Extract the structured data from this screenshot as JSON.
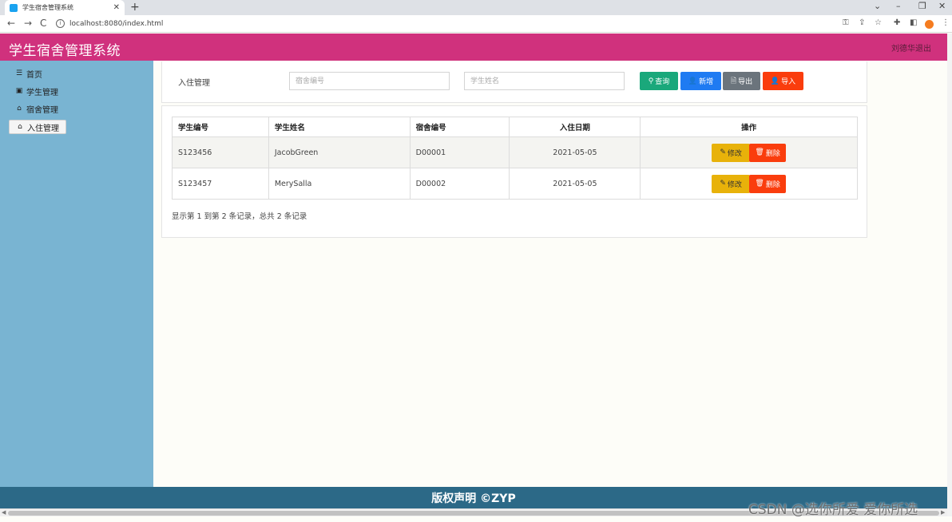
{
  "browser": {
    "tab_title": "学生宿舍管理系统",
    "url": "localhost:8080/index.html"
  },
  "app": {
    "title": "学生宿舍管理系统",
    "user_logout": "刘德华退出"
  },
  "sidebar": {
    "items": [
      {
        "label": "首页",
        "icon": "list-icon"
      },
      {
        "label": "学生管理",
        "icon": "book-icon"
      },
      {
        "label": "宿舍管理",
        "icon": "home-icon"
      },
      {
        "label": "入住管理",
        "icon": "home-icon",
        "active": true
      }
    ]
  },
  "search": {
    "section_label": "入住管理",
    "dorm_placeholder": "宿舍编号",
    "student_placeholder": "学生姓名",
    "buttons": {
      "query": "查询",
      "add": "新增",
      "export": "导出",
      "import": "导入"
    }
  },
  "table": {
    "headers": [
      "学生编号",
      "学生姓名",
      "宿舍编号",
      "入住日期",
      "操作"
    ],
    "rows": [
      {
        "student_id": "S123456",
        "student_name": "JacobGreen",
        "dorm_id": "D00001",
        "date": "2021-05-05"
      },
      {
        "student_id": "S123457",
        "student_name": "MerySalla",
        "dorm_id": "D00002",
        "date": "2021-05-05"
      }
    ],
    "edit_label": "修改",
    "delete_label": "删除",
    "pagination_text": "显示第 1 到第 2 条记录，总共 2 条记录"
  },
  "footer": {
    "text": "版权声明 ©ZYP"
  },
  "watermark": "CSDN @选你所爱 爱你所选",
  "colors": {
    "header": "#d0317d",
    "sidebar": "#79b4d2",
    "footer": "#2c6987",
    "btn_query": "#1aa87b",
    "btn_add": "#1f7bf2",
    "btn_export": "#6b747c",
    "btn_import": "#fa3d0d",
    "btn_edit": "#e8b20a",
    "btn_delete": "#fa3d0d"
  }
}
